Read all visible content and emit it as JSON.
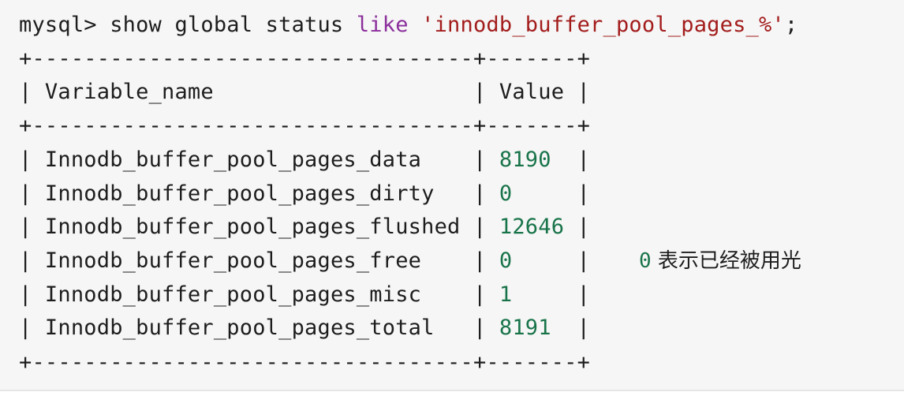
{
  "prompt": {
    "prefix": "mysql> show global status ",
    "keyword": "like",
    "space": " ",
    "pattern": "'innodb_buffer_pool_pages_%'",
    "terminator": ";"
  },
  "table": {
    "border": "+----------------------------------+-------+",
    "header": {
      "lead": "| ",
      "name": "Variable_name",
      "name_pad": "                    ",
      "sep": "| ",
      "value": "Value",
      "tail": " |"
    },
    "rows": [
      {
        "lead": "| ",
        "name": "Innodb_buffer_pool_pages_data",
        "pad": "    ",
        "sep": "| ",
        "value": "8190",
        "tail": "  |"
      },
      {
        "lead": "| ",
        "name": "Innodb_buffer_pool_pages_dirty",
        "pad": "   ",
        "sep": "| ",
        "value": "0",
        "tail": "     |"
      },
      {
        "lead": "| ",
        "name": "Innodb_buffer_pool_pages_flushed",
        "pad": " ",
        "sep": "| ",
        "value": "12646",
        "tail": " |"
      },
      {
        "lead": "| ",
        "name": "Innodb_buffer_pool_pages_free",
        "pad": "    ",
        "sep": "| ",
        "value": "0",
        "tail": "     |"
      },
      {
        "lead": "| ",
        "name": "Innodb_buffer_pool_pages_misc",
        "pad": "    ",
        "sep": "| ",
        "value": "1",
        "tail": "     |"
      },
      {
        "lead": "| ",
        "name": "Innodb_buffer_pool_pages_total",
        "pad": "   ",
        "sep": "| ",
        "value": "8191",
        "tail": "  |"
      }
    ]
  },
  "annotation": {
    "zero": "0",
    "text": " 表示已经被用光"
  },
  "colors": {
    "background": "#f6f6f6",
    "keyword": "#8b2f9c",
    "string": "#a31c1c",
    "number": "#19744a",
    "text": "#1d1d1d"
  }
}
